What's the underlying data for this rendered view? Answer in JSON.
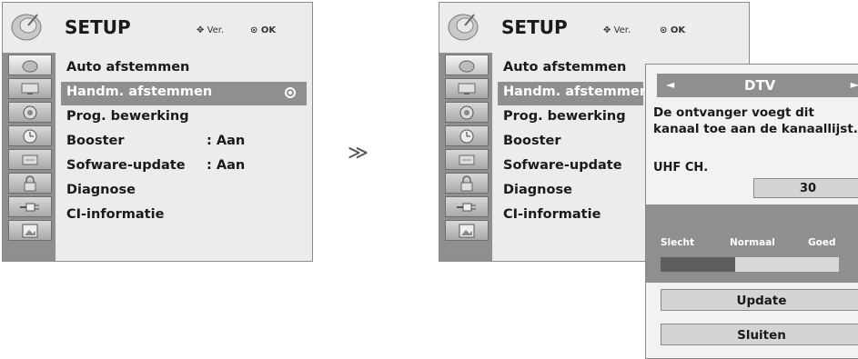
{
  "menu": {
    "title": "SETUP",
    "nav_hint": "Ver.",
    "ok_hint": "OK",
    "sidebar_icons": [
      "satellite-dish-icon",
      "monitor-icon",
      "speaker-icon",
      "clock-icon",
      "keyboard-icon",
      "lock-icon",
      "plug-icon",
      "picture-icon"
    ]
  },
  "left": {
    "items": [
      {
        "label": "Auto afstemmen",
        "value": ""
      },
      {
        "label": "Handm. afstemmen",
        "value": ""
      },
      {
        "label": "Prog. bewerking",
        "value": ""
      },
      {
        "label": "Booster",
        "value": ": Aan"
      },
      {
        "label": "Sofware-update",
        "value": ": Aan"
      },
      {
        "label": "Diagnose",
        "value": ""
      },
      {
        "label": "CI-informatie",
        "value": ""
      }
    ],
    "selected_index": 1
  },
  "right": {
    "items": [
      {
        "label": "Auto afstemmen"
      },
      {
        "label": "Handm. afstemmen"
      },
      {
        "label": "Prog. bewerking"
      },
      {
        "label": "Booster"
      },
      {
        "label": "Sofware-update"
      },
      {
        "label": "Diagnose"
      },
      {
        "label": "CI-informatie"
      }
    ],
    "selected_index": 1
  },
  "transition_arrow": "≫",
  "popup": {
    "arrow_left": "◄",
    "mode": "DTV",
    "arrow_right": "►",
    "message": "De ontvanger voegt dit kanaal toe aan de kanaallijst.",
    "uhf_label": "UHF CH.",
    "uhf_value": "30",
    "signal_bad": "Slecht",
    "signal_normal": "Normaal",
    "signal_good": "Goed",
    "signal_level": 0.42,
    "update_label": "Update",
    "close_label": "Sluiten"
  }
}
